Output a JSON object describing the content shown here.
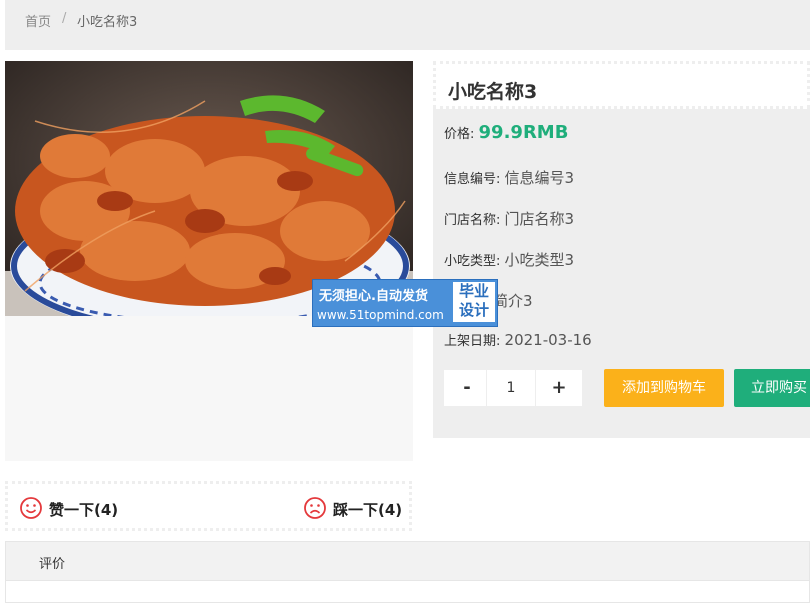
{
  "breadcrumb": {
    "home": "首页",
    "separator": "/",
    "current": "小吃名称3"
  },
  "product": {
    "title": "小吃名称3",
    "price_label": "价格:",
    "price_value": "99.9RMB",
    "fields": [
      {
        "label": "信息编号:",
        "value": "信息编号3"
      },
      {
        "label": "门店名称:",
        "value": "门店名称3"
      },
      {
        "label": "小吃类型:",
        "value": "小吃类型3"
      },
      {
        "label": "",
        "value": "简介3"
      },
      {
        "label": "上架日期:",
        "value": "2021-03-16"
      }
    ],
    "quantity": {
      "minus": "-",
      "value": "1",
      "plus": "+"
    },
    "buttons": {
      "add_to_cart": "添加到购物车",
      "buy_now": "立即购买"
    }
  },
  "watermark": {
    "line1": "无须担心.自动发货",
    "line2": "www.51topmind.com",
    "box": "毕业设计"
  },
  "votes": {
    "like_label": "赞一下(4)",
    "like_icon": "smile-icon",
    "dislike_label": "踩一下(4)",
    "dislike_icon": "sad-face-icon"
  },
  "reviews": {
    "title": "评价"
  },
  "colors": {
    "green": "#1fae7b",
    "orange": "#fbb11a",
    "icon_red": "#e4393c"
  }
}
